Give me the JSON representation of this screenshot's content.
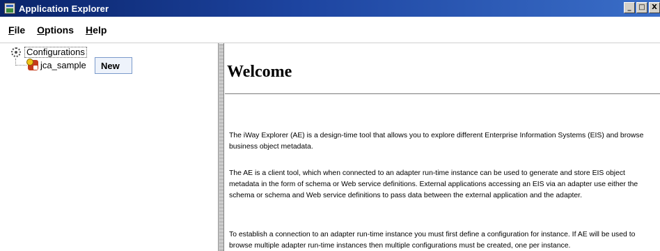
{
  "window": {
    "title": "Application Explorer",
    "controls": {
      "minimize": "_",
      "maximize": "□",
      "close": "X"
    }
  },
  "menubar": {
    "items": [
      "File",
      "Options",
      "Help"
    ]
  },
  "tree": {
    "root_label": "Configurations",
    "child_label": "jca_sample",
    "root_icon": "gear-icon",
    "child_icon": "adapter-icon"
  },
  "context_menu": {
    "items": [
      "New"
    ]
  },
  "content": {
    "heading": "Welcome",
    "paragraphs": [
      "The iWay Explorer (AE) is a design-time tool that allows you to explore different Enterprise Information Systems (EIS) and browse business object metadata.",
      "The AE is a client tool, which when connected to an adapter run-time instance can be used to generate and store EIS object metadata in the form of schema or Web service definitions. External applications accessing an EIS via an adapter use either the schema or schema and Web service definitions to pass data between the external application and the adapter.",
      "To establish a connection to an adapter run-time instance you must first define a configuration for instance. If AE will be used to browse multiple adapter run-time instances then multiple configurations must be created, one per instance."
    ]
  },
  "colors": {
    "titlebar_start": "#0a246a",
    "titlebar_end": "#3a6ec8",
    "context_menu_bg": "#eef3fb"
  }
}
